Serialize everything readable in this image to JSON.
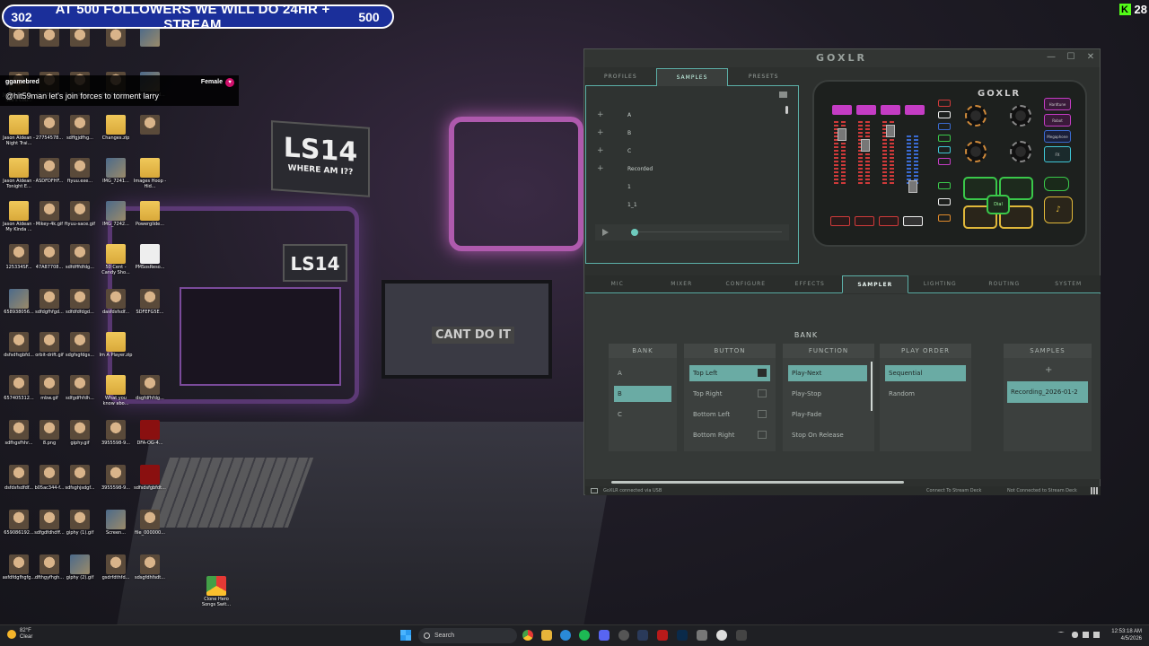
{
  "banner": {
    "count": "302",
    "message": "AT 500 FOLLOWERS WE WILL DO 24HR + STREAM",
    "goal": "500"
  },
  "kick": {
    "count": "28"
  },
  "background": {
    "sign1_big": "LS14",
    "sign1_small": "WHERE AM I??",
    "sign2_big": "LS14",
    "monitor_text": "CANT DO IT"
  },
  "chat": {
    "username": "ggamebred",
    "tag": "Female",
    "message": "@hit59man let's join forces to torment larry"
  },
  "desktop_icons": [
    {
      "label": "",
      "type": "face"
    },
    {
      "label": "",
      "type": "face"
    },
    {
      "label": "",
      "type": "face"
    },
    {
      "label": "",
      "type": "face"
    },
    {
      "label": "Jason Aldean - She's Cou...",
      "type": "face"
    },
    {
      "label": "IFDFSDGF...",
      "type": "face"
    },
    {
      "label": "sdfgdfhdd...",
      "type": "face"
    },
    {
      "label": "XDCFGDFH...",
      "type": "face"
    },
    {
      "label": "Jason Aldean - Night Trai...",
      "type": "folder"
    },
    {
      "label": "27754578...",
      "type": "face"
    },
    {
      "label": "sdffgjdfhg...",
      "type": "face"
    },
    {
      "label": "Changes.zip",
      "type": "folder"
    },
    {
      "label": "Jason Aldean - Tonight E...",
      "type": "folder"
    },
    {
      "label": "ASDFDFHF...",
      "type": "face"
    },
    {
      "label": "ftyuu.exe...",
      "type": "face"
    },
    {
      "label": "IMG_7241...",
      "type": "img"
    },
    {
      "label": "Jason Aldean - My Kinda ...",
      "type": "folder"
    },
    {
      "label": "Mikey-4k.gif",
      "type": "face"
    },
    {
      "label": "ftyuu-sace.gif",
      "type": "face"
    },
    {
      "label": "IMG_7242...",
      "type": "img"
    },
    {
      "label": "125334SF...",
      "type": "face"
    },
    {
      "label": "47A87708...",
      "type": "face"
    },
    {
      "label": "sdfdfffdfdg...",
      "type": "face"
    },
    {
      "label": "50 Cent - Candy Sho...",
      "type": "folder"
    },
    {
      "label": "658938056...",
      "type": "img"
    },
    {
      "label": "sdfdgfhfgd...",
      "type": "face"
    },
    {
      "label": "sdfdfdfdgd...",
      "type": "face"
    },
    {
      "label": "dasfdsfsdf...",
      "type": "face"
    },
    {
      "label": "dsfsdfsgbfd...",
      "type": "face"
    },
    {
      "label": "orbit-drift.gif",
      "type": "face"
    },
    {
      "label": "sdgfsgfdgs...",
      "type": "face"
    },
    {
      "label": "Im A Player.zip",
      "type": "folder"
    },
    {
      "label": "657405312...",
      "type": "face"
    },
    {
      "label": "mbw.gif",
      "type": "face"
    },
    {
      "label": "sdfgdfhfdh...",
      "type": "face"
    },
    {
      "label": "What you know abo...",
      "type": "folder"
    },
    {
      "label": "sdfhgsfhhr...",
      "type": "face"
    },
    {
      "label": "8.png",
      "type": "face"
    },
    {
      "label": "giphy.gif",
      "type": "face"
    },
    {
      "label": "3955598-9...",
      "type": "face"
    },
    {
      "label": "dsfdsfsdfdf...",
      "type": "face"
    },
    {
      "label": "b05ac344-f...",
      "type": "face"
    },
    {
      "label": "sdfsghjsdgf...",
      "type": "face"
    },
    {
      "label": "3955598-9...",
      "type": "face"
    },
    {
      "label": "659086192...",
      "type": "face"
    },
    {
      "label": "sdfgdfdhdff...",
      "type": "face"
    },
    {
      "label": "giphy (1).gif",
      "type": "face"
    },
    {
      "label": "Screen...",
      "type": "img"
    },
    {
      "label": "asfdfdgfhgfg...",
      "type": "face"
    },
    {
      "label": "dfthgyfhgh...",
      "type": "face"
    },
    {
      "label": "giphy (2).gif",
      "type": "img"
    },
    {
      "label": "gsdrfdthfd...",
      "type": "face"
    }
  ],
  "desktop_icons_col5": [
    {
      "label": "",
      "type": "img"
    },
    {
      "label": "dfhgfgdfsfd...",
      "type": "img"
    },
    {
      "label": "",
      "type": "face"
    },
    {
      "label": "Images Hoop - Hid...",
      "type": "folder"
    },
    {
      "label": "Powerglide...",
      "type": "folder"
    },
    {
      "label": "PMSosReso...",
      "type": "doc"
    },
    {
      "label": "SDFEFG5E...",
      "type": "face"
    },
    {
      "label": "dsgfdfhfdg...",
      "type": "face"
    },
    {
      "label": "DFA-OG-4...",
      "type": "red"
    },
    {
      "label": "sdfsdsfgbfdt...",
      "type": "red"
    },
    {
      "label": "file_000000...",
      "type": "face"
    },
    {
      "label": "sdsgfdhfsdt...",
      "type": "face"
    },
    {
      "label": "Clone Hero Songs Swit...",
      "type": "chrome"
    }
  ],
  "goxlr": {
    "title_logo": "GOXLR",
    "window_buttons": [
      "—",
      "☐",
      "✕"
    ],
    "top_tabs": [
      {
        "label": "PROFILES",
        "active": false
      },
      {
        "label": "SAMPLES",
        "active": true
      },
      {
        "label": "PRESETS",
        "active": false
      }
    ],
    "sample_list": [
      {
        "label": "A",
        "plus": true
      },
      {
        "label": "B",
        "plus": true
      },
      {
        "label": "C",
        "plus": true
      },
      {
        "label": "Recorded",
        "plus": true
      },
      {
        "label": "1",
        "plus": false
      },
      {
        "label": "1_1",
        "plus": false
      }
    ],
    "device_logo": "GOXLR",
    "device_pad_center": "Dial",
    "device_side_buttons": [
      "Hardtune",
      "Robot",
      "Megaphone",
      "FX",
      "Cough"
    ],
    "main_tabs": [
      {
        "label": "MIC",
        "active": false
      },
      {
        "label": "MIXER",
        "active": false
      },
      {
        "label": "CONFIGURE",
        "active": false
      },
      {
        "label": "EFFECTS",
        "active": false
      },
      {
        "label": "SAMPLER",
        "active": true
      },
      {
        "label": "LIGHTING",
        "active": false
      },
      {
        "label": "ROUTING",
        "active": false
      },
      {
        "label": "SYSTEM",
        "active": false
      }
    ],
    "sampler": {
      "bank_title": "BANK",
      "columns": {
        "bank": {
          "header": "BANK",
          "items": [
            "A",
            "B",
            "C"
          ],
          "selected": 1
        },
        "button": {
          "header": "BUTTON",
          "items": [
            "Top Left",
            "Top Right",
            "Bottom Left",
            "Bottom Right"
          ],
          "selected": 0
        },
        "function": {
          "header": "FUNCTION",
          "items": [
            "Play-Next",
            "Play-Stop",
            "Play-Fade",
            "Stop On Release"
          ],
          "selected": 0
        },
        "play_order": {
          "header": "PLAY ORDER",
          "items": [
            "Sequential",
            "Random"
          ],
          "selected": 0
        },
        "samples": {
          "header": "SAMPLES",
          "add": "+",
          "items": [
            "Recording_2026-01-2"
          ]
        }
      }
    },
    "status": {
      "left": "GoXLR connected via USB",
      "mid": "Connect To Stream Deck",
      "right": "Not Connected to Stream Deck"
    }
  },
  "taskbar": {
    "weather_temp": "82°F",
    "weather_desc": "Clear",
    "search_placeholder": "Search",
    "time": "12:53:18 AM",
    "date": "4/5/2026"
  }
}
